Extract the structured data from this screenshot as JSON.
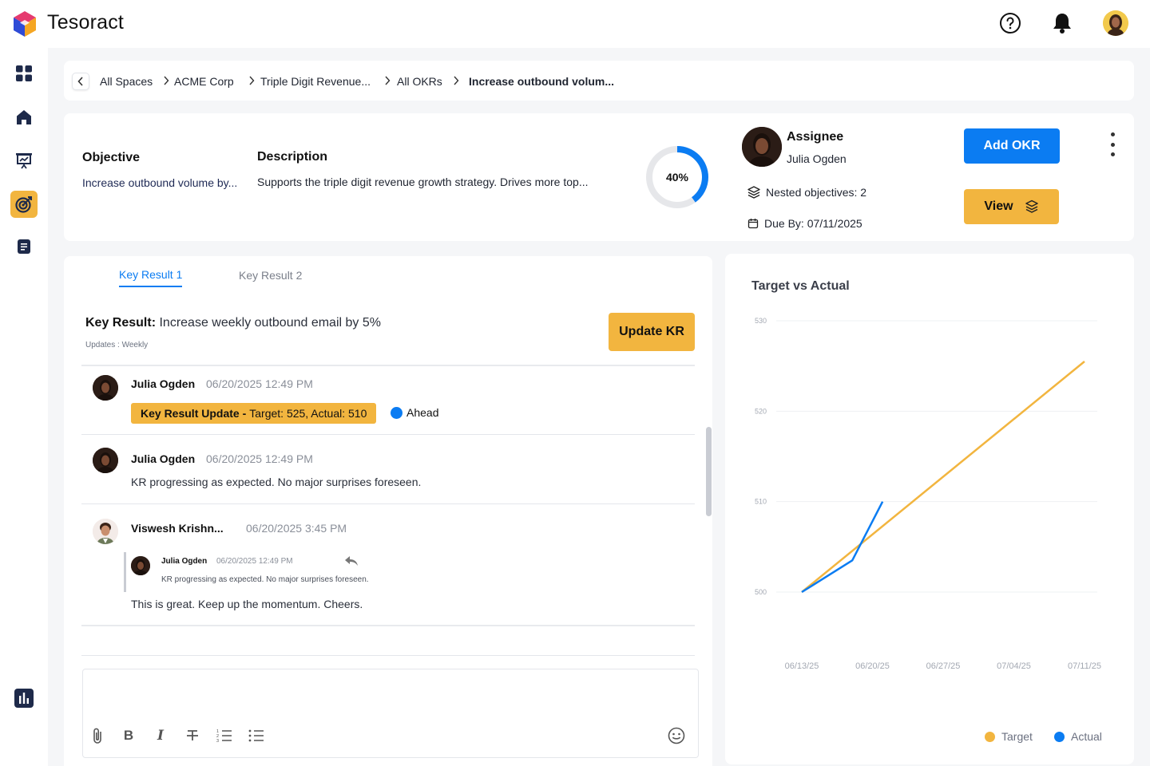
{
  "app": {
    "brand": "Tesoract"
  },
  "colors": {
    "accent": "#0b7cf2",
    "highlight": "#f2b53f",
    "target_line": "#f2b53f",
    "actual_line": "#0b7cf2"
  },
  "topbar": {
    "icons": [
      "help-icon",
      "bell-icon",
      "user-avatar"
    ]
  },
  "sidebar": {
    "items": [
      "dashboard-icon",
      "home-icon",
      "presentation-icon",
      "target-icon",
      "document-icon",
      "reports-icon"
    ],
    "active": "target-icon"
  },
  "breadcrumb": {
    "items": [
      "All Spaces",
      "ACME Corp",
      "Triple Digit Revenue...",
      "All OKRs",
      "Increase outbound volum..."
    ]
  },
  "objective": {
    "label": "Objective",
    "value": "Increase outbound volume by...",
    "description_label": "Description",
    "description": "Supports the triple digit revenue growth strategy. Drives more top...",
    "progress": 40,
    "progress_text": "40%",
    "assignee_label": "Assignee",
    "assignee_name": "Julia Ogden",
    "nested": "Nested objectives: 2",
    "due": "Due By: 07/11/2025",
    "add_button": "Add OKR",
    "view_button": "View"
  },
  "key_results": {
    "tabs": [
      "Key Result 1",
      "Key Result 2"
    ],
    "active_tab": 0,
    "kr_label": "Key Result:",
    "kr_text": "Increase weekly outbound email by 5%",
    "updates": "Updates : Weekly",
    "update_button": "Update KR",
    "comments": [
      {
        "name": "Julia Ogden",
        "time": "06/20/2025 12:49 PM",
        "badge_label": "Key Result Update -",
        "badge_text": "Target: 525, Actual: 510",
        "status": "Ahead"
      },
      {
        "name": "Julia Ogden",
        "time": "06/20/2025 12:49 PM",
        "text": "KR progressing as expected. No major surprises foreseen."
      },
      {
        "name": "Viswesh Krishn...",
        "time": "06/20/2025 3:45 PM",
        "quote": {
          "name": "Julia Ogden",
          "time": "06/20/2025 12:49 PM",
          "text": "KR progressing as expected. No major surprises foreseen."
        },
        "text": "This is great. Keep up the momentum. Cheers."
      }
    ],
    "editor_tools": [
      "attach-icon",
      "bold-icon",
      "italic-icon",
      "strikethrough-icon",
      "numbered-list-icon",
      "bullet-list-icon",
      "emoji-icon"
    ]
  },
  "chart_data": {
    "type": "line",
    "title": "Target vs Actual",
    "x": [
      "06/13/25",
      "06/20/25",
      "06/27/25",
      "07/04/25",
      "07/11/25"
    ],
    "ylim": [
      500,
      530
    ],
    "yticks": [
      500,
      510,
      520,
      530
    ],
    "grid": true,
    "legend": "bottom-right",
    "series": [
      {
        "name": "Target",
        "color": "#f2b53f",
        "points": [
          [
            "06/13/25",
            500
          ],
          [
            "07/11/25",
            525.5
          ]
        ]
      },
      {
        "name": "Actual",
        "color": "#0b7cf2",
        "points": [
          [
            "06/13/25",
            500
          ],
          [
            "06/18/25",
            503.5
          ],
          [
            "06/21/25",
            510
          ]
        ]
      }
    ]
  }
}
